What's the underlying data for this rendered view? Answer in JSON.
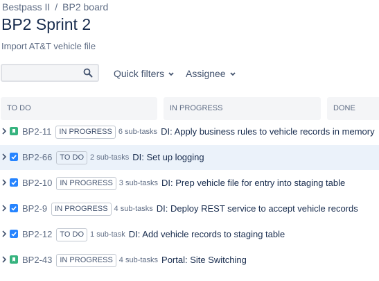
{
  "breadcrumb": {
    "project": "Bestpass II",
    "separator": "/",
    "board": "BP2 board"
  },
  "page": {
    "title": "BP2 Sprint 2",
    "subtitle": "Import AT&T vehicle file"
  },
  "toolbar": {
    "search_placeholder": "",
    "search_value": "",
    "quick_filters_label": "Quick filters",
    "assignee_label": "Assignee"
  },
  "columns": [
    {
      "label": "TO DO"
    },
    {
      "label": "IN PROGRESS"
    },
    {
      "label": "DONE"
    }
  ],
  "colors": {
    "story_icon": "#36b37e",
    "task_icon": "#2684ff",
    "highlight_row": "#ebf2fa"
  },
  "issues": [
    {
      "key": "BP2-11",
      "type_icon": "story-icon",
      "status": "IN PROGRESS",
      "subtasks": "6 sub-tasks",
      "summary": "DI: Apply business rules to vehicle records in memory",
      "highlighted": false
    },
    {
      "key": "BP2-66",
      "type_icon": "task-icon",
      "status": "TO DO",
      "subtasks": "2 sub-tasks",
      "summary": "DI: Set up logging",
      "highlighted": true
    },
    {
      "key": "BP2-10",
      "type_icon": "task-icon",
      "status": "IN PROGRESS",
      "subtasks": "3 sub-tasks",
      "summary": "DI: Prep vehicle file for entry into staging table",
      "highlighted": false
    },
    {
      "key": "BP2-9",
      "type_icon": "task-icon",
      "status": "IN PROGRESS",
      "subtasks": "4 sub-tasks",
      "summary": "DI: Deploy REST service to accept vehicle records",
      "highlighted": false
    },
    {
      "key": "BP2-12",
      "type_icon": "task-icon",
      "status": "TO DO",
      "subtasks": "1 sub-task",
      "summary": "DI: Add vehicle records to staging table",
      "highlighted": false
    },
    {
      "key": "BP2-43",
      "type_icon": "story-icon",
      "status": "IN PROGRESS",
      "subtasks": "4 sub-tasks",
      "summary": "Portal: Site Switching",
      "highlighted": false
    }
  ]
}
